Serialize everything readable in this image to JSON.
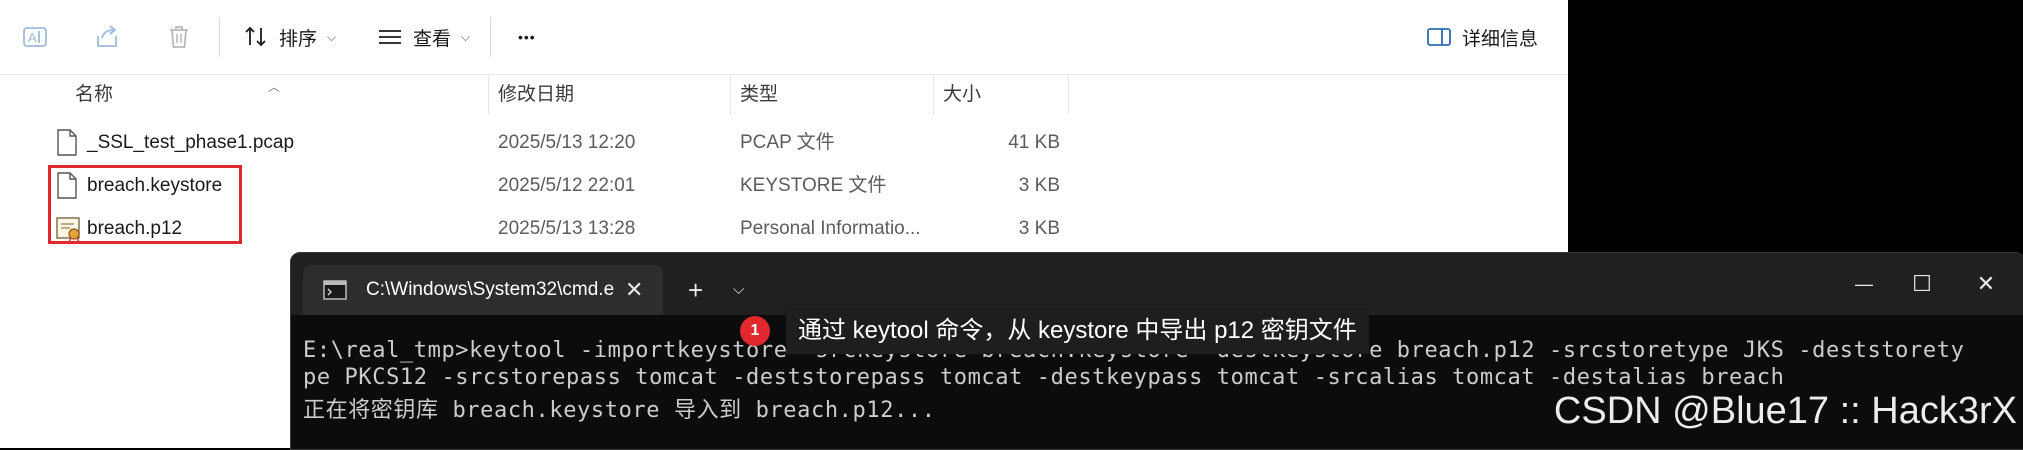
{
  "toolbar": {
    "sort_label": "排序",
    "view_label": "查看",
    "more_label": "•••",
    "details_label": "详细信息"
  },
  "columns": {
    "name": "名称",
    "date": "修改日期",
    "type": "类型",
    "size": "大小"
  },
  "files": [
    {
      "name": "_SSL_test_phase1.pcap",
      "date": "2025/5/13 12:20",
      "type": "PCAP 文件",
      "size": "41 KB",
      "icon": "document-icon"
    },
    {
      "name": "breach.keystore",
      "date": "2025/5/12 22:01",
      "type": "KEYSTORE 文件",
      "size": "3 KB",
      "icon": "document-icon"
    },
    {
      "name": "breach.p12",
      "date": "2025/5/13 13:28",
      "type": "Personal Informatio...",
      "size": "3 KB",
      "icon": "certificate-icon"
    }
  ],
  "colors": {
    "highlight": "#e0282e",
    "terminal_bg": "#0c0c0c",
    "terminal_titlebar": "#202020"
  },
  "terminal": {
    "tab_title": "C:\\Windows\\System32\\cmd.e",
    "tab_close": "✕",
    "new_tab": "+",
    "dropdown": "⌵",
    "minimize": "—",
    "maximize": "☐",
    "close": "✕",
    "lines": [
      "E:\\real_tmp>keytool -importkeystore -srckeystore breach.keystore -destkeystore breach.p12 -srcstoretype JKS -deststorety",
      "pe PKCS12 -srcstorepass tomcat -deststorepass tomcat -destkeypass tomcat -srcalias tomcat -destalias breach",
      "正在将密钥库 breach.keystore 导入到 breach.p12..."
    ]
  },
  "annotation": {
    "number": "1",
    "text": "通过 keytool 命令，从 keystore 中导出 p12 密钥文件"
  },
  "watermark": "CSDN @Blue17 :: Hack3rX"
}
